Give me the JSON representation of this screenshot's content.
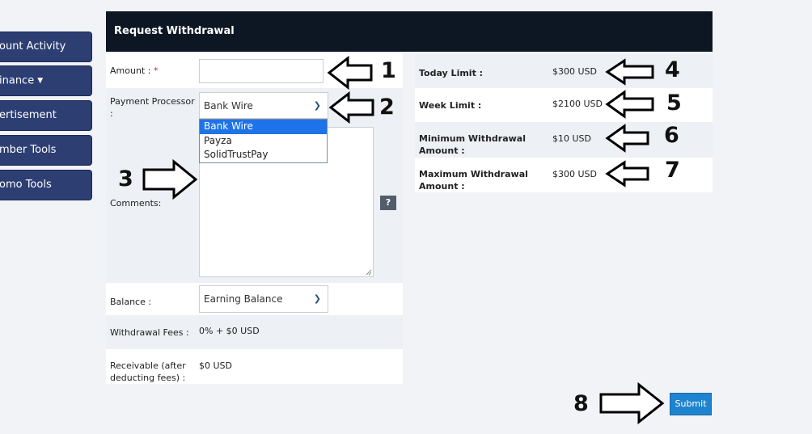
{
  "sidebar": {
    "items": [
      {
        "label": "ount Activity"
      },
      {
        "label": "inance"
      },
      {
        "label": "ertisement"
      },
      {
        "label": "mber Tools"
      },
      {
        "label": "omo Tools"
      }
    ]
  },
  "panel": {
    "title": "Request Withdrawal"
  },
  "form": {
    "amount_label": "Amount :",
    "required_mark": "*",
    "amount_value": "",
    "processor_label": "Payment Processor :",
    "processor_selected": "Bank Wire",
    "processor_options": [
      "Bank Wire",
      "Payza",
      "SolidTrustPay"
    ],
    "comments_label": "Comments:",
    "help_label": "?",
    "balance_label": "Balance :",
    "balance_selected": "Earning Balance",
    "fees_label": "Withdrawal Fees :",
    "fees_value": "0% + $0 USD",
    "receivable_label": "Receivable (after deducting fees) :",
    "receivable_value": "$0 USD"
  },
  "limits": {
    "today_label": "Today Limit :",
    "today_value": "$300 USD",
    "week_label": "Week Limit :",
    "week_value": "$2100 USD",
    "min_label": "Minimum Withdrawal Amount :",
    "min_value": "$10 USD",
    "max_label": "Maximum Withdrawal Amount :",
    "max_value": "$300 USD"
  },
  "submit_label": "Submit",
  "annotations": [
    "1",
    "2",
    "3",
    "4",
    "5",
    "6",
    "7",
    "8"
  ],
  "icons": {
    "chevron": "chevron-down-icon",
    "caret": "caret-down-icon",
    "arrow": "outline-arrow-icon"
  },
  "colors": {
    "sidebar": "#2d3e73",
    "header": "#0d1724",
    "submit": "#1f84cf",
    "selection": "#1e73e8"
  }
}
